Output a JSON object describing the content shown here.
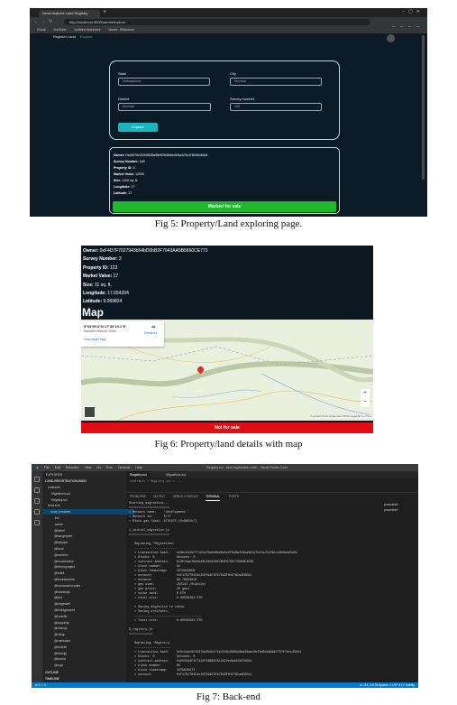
{
  "fig5": {
    "tab_title": "Decentralized Land Registry",
    "url": "http://localhost:3000/admin/explore",
    "bookmarks": [
      "Gmail",
      "YouTube",
      "Untitled document",
      "Home - Ethereum"
    ],
    "nav": {
      "register": "Register Land",
      "explore": "Explore"
    },
    "form": {
      "state_label": "State",
      "state_value": "Maharashtra",
      "city_label": "City",
      "city_value": "Mumbai",
      "district_label": "District",
      "district_value": "Mumbai",
      "survey_label": "Survey number",
      "survey_value": "180",
      "explore_button": "Explore"
    },
    "details": {
      "owner_label": "Owner:",
      "owner_value": "0xd3678c2f2f4f838a98ef29e8ebe4b5a423c47600b4b5d1",
      "survey_label": "Survey Number:",
      "survey_value": "180",
      "property_label": "Property ID:",
      "property_value": "4",
      "market_label": "Market Value:",
      "market_value": "12000",
      "size_label": "Size:",
      "size_value": "1100 sq. ft.",
      "longitude_label": "Longitude:",
      "longitude_value": "17",
      "latitude_label": "Latitude:",
      "latitude_value": "17",
      "status_button": "Marked for sale"
    },
    "caption": "Fig 5: Property/Land exploring page."
  },
  "fig6": {
    "owner_label": "Owner:",
    "owner_value": "0xF4D7F7027943b54bD0bB2F7043AA5B5660CE773",
    "survey_label": "Survey Number:",
    "survey_value": "2",
    "property_label": "Property ID:",
    "property_value": "122",
    "market_label": "Market Value:",
    "market_value": "17",
    "size_label": "Size:",
    "size_value": "11 sq. ft.",
    "longitude_label": "Longitude:",
    "longitude_value": "17.654204",
    "latitude_label": "Latitude:",
    "latitude_value": "9.069824",
    "map_title": "Map",
    "map_info": {
      "coords": "9°03'59.3\"N 17°39'15.1\"E",
      "place": "Mandoul Oriental, Chad",
      "link": "View larger map",
      "directions": "Directions"
    },
    "map_attribution": "Keyboard shortcuts  Map data ©2023 Google  Terms of Use",
    "status_button": "Not for sale",
    "caption": "Fig 6: Property/land details with map"
  },
  "fig7": {
    "menu": [
      "File",
      "Edit",
      "Selection",
      "View",
      "Go",
      "Run",
      "Terminal",
      "Help"
    ],
    "window_title": "Registry.sol - land-registration-main - Visual Studio Code",
    "explorer_title": "EXPLORER",
    "root": "LAND-REGISTRATION-MAIN",
    "tree": [
      "contracts",
      "Migrations.sol",
      "Registry.sol",
      "front-end",
      "node_modules",
      ".bin",
      ".cache",
      "@babel",
      "@bangerjoint",
      "@babylon",
      "@bcoe",
      "@emotion",
      "@ensdomains",
      "@ethersproject",
      "@eslint",
      "@fortawesome",
      "@humanwhocodes",
      "@istanbuljs",
      "@jest",
      "@jridgewell",
      "@leichtgewicht",
      "@nodelib",
      "@popperjs",
      "@reduxjs",
      "@rollup",
      "@rushstack",
      "@sinclair",
      "@sinonjs",
      "@surma",
      "@svgr"
    ],
    "outline_label": "OUTLINE",
    "timeline_label": "TIMELINE",
    "tabs": [
      "Registry.sol",
      "Migrations.sol"
    ],
    "breadcrumb": "contracts > Registry.sol > ...",
    "panel_tabs": [
      "PROBLEMS",
      "OUTPUT",
      "DEBUG CONSOLE",
      "TERMINAL",
      "PORTS"
    ],
    "terminal_sessions": [
      "powershell",
      "powershell"
    ],
    "terminal": [
      "Starting migrations...",
      "======================",
      "> Network name:    'development'",
      "> Network id:      5777",
      "> Block gas limit: 6721975 (0x6691b7)",
      "",
      "1_initial_migration.js",
      "======================",
      "",
      "   Replacing 'Migrations'",
      "   ----------------------",
      "   > transaction hash:    0x8ece419f77155d76e8e6bb6e3c0f5e9a2c6aa9b5d7e1fa72c0b1c19e6a4e5d0c",
      "   > Blocks: 0            Seconds: 0",
      "   > contract address:    0xdE7dae79A49A2526932AE2B3F8786770886E2E36",
      "   > block number:        83",
      "   > block timestamp:     1679925858",
      "   > account:             0xF17E2704CAc2CE594F2F97D43F0457B2a4E8Ed1",
      "   > balance:             99.70693818",
      "   > gas used:            250142 (0x3d11e)",
      "   > gas price:           20 gwei",
      "   > value sent:          0 ETH",
      "   > total cost:          0.00500284 ETH",
      "",
      "   > Saving migration to chain.",
      "   > Saving artifacts",
      "   -------------------------------------",
      "   > Total cost:          0.00500284 ETH",
      "",
      "2_registry.js",
      "=============",
      "",
      "   Replacing 'Registry'",
      "   --------------------",
      "   > transaction hash:    0x5c2adc95f637de0b4e172e4f46c9968d8ba36aac0bf0d9c6a8bb7707f7ecc25e5d",
      "   > Blocks: 0            Seconds: 0",
      "   > contract address:    0x055594F2C7122F33B6D7A12822e4bd41997b801",
      "   > block number:        85",
      "   > block timestamp:     1679925873",
      "   > account:             0xF17E2704CAc2CE594F2F97D43F0457B2a4E8Ed1"
    ],
    "status_left": "⊗ 0 ⚠ 0",
    "status_right": "Ln 114, Col 26   Spaces: 4   UTF-8   LF   Solidity",
    "caption": "Fig 7: Back-end"
  }
}
